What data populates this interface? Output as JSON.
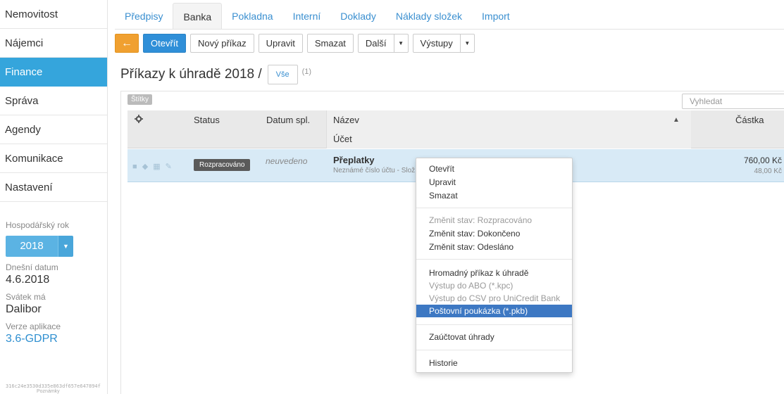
{
  "sidebar": {
    "items": [
      {
        "label": "Nemovitost"
      },
      {
        "label": "Nájemci"
      },
      {
        "label": "Finance"
      },
      {
        "label": "Správa"
      },
      {
        "label": "Agendy"
      },
      {
        "label": "Komunikace"
      },
      {
        "label": "Nastavení"
      }
    ],
    "fiscal_year_label": "Hospodářský rok",
    "fiscal_year_value": "2018",
    "today_label": "Dnešní datum",
    "today_value": "4.6.2018",
    "nameday_label": "Svátek má",
    "nameday_value": "Dalibor",
    "version_label": "Verze aplikace",
    "version_value": "3.6-GDPR",
    "build_hash": "316c24e3530d335e863df657e647894f",
    "build_hash2": "Poznámky"
  },
  "tabs": [
    "Předpisy",
    "Banka",
    "Pokladna",
    "Interní",
    "Doklady",
    "Náklady složek",
    "Import"
  ],
  "toolbar": {
    "back_icon": "←",
    "open": "Otevřít",
    "new_order": "Nový příkaz",
    "edit": "Upravit",
    "delete": "Smazat",
    "more": "Další",
    "outputs": "Výstupy"
  },
  "page": {
    "title": "Příkazy k úhradě 2018 /",
    "filter": "Vše",
    "count": "(1)",
    "tags": "Štítky",
    "search_placeholder": "Vyhledat"
  },
  "table": {
    "headers": {
      "status": "Status",
      "due": "Datum spl.",
      "name": "Název",
      "account": "Účet",
      "amount": "Částka"
    },
    "rows": [
      {
        "status": "Rozpracováno",
        "due": "neuvedeno",
        "name": "Přeplatky",
        "account": "Neznámé číslo účtu - Slož",
        "amount": "760,00 Kč",
        "amount_sub": "48,00 Kč"
      }
    ]
  },
  "context_menu": {
    "open": "Otevřít",
    "edit": "Upravit",
    "delete": "Smazat",
    "state_in_progress": "Změnit stav: Rozpracováno",
    "state_done": "Změnit stav: Dokončeno",
    "state_sent": "Změnit stav: Odesláno",
    "bulk_order": "Hromadný příkaz k úhradě",
    "abo_export": "Výstup do ABO (*.kpc)",
    "csv_export": "Výstup do CSV pro UniCredit Bank",
    "postal_order": "Poštovní poukázka (*.pkb)",
    "book_payments": "Zaúčtovat úhrady",
    "history": "Historie"
  },
  "colors": {
    "accent": "#35a5dc",
    "primary_button": "#2f8fd8",
    "back_button": "#f0a030",
    "selected_row": "#d8eaf6",
    "menu_highlight": "#3d78c3"
  }
}
